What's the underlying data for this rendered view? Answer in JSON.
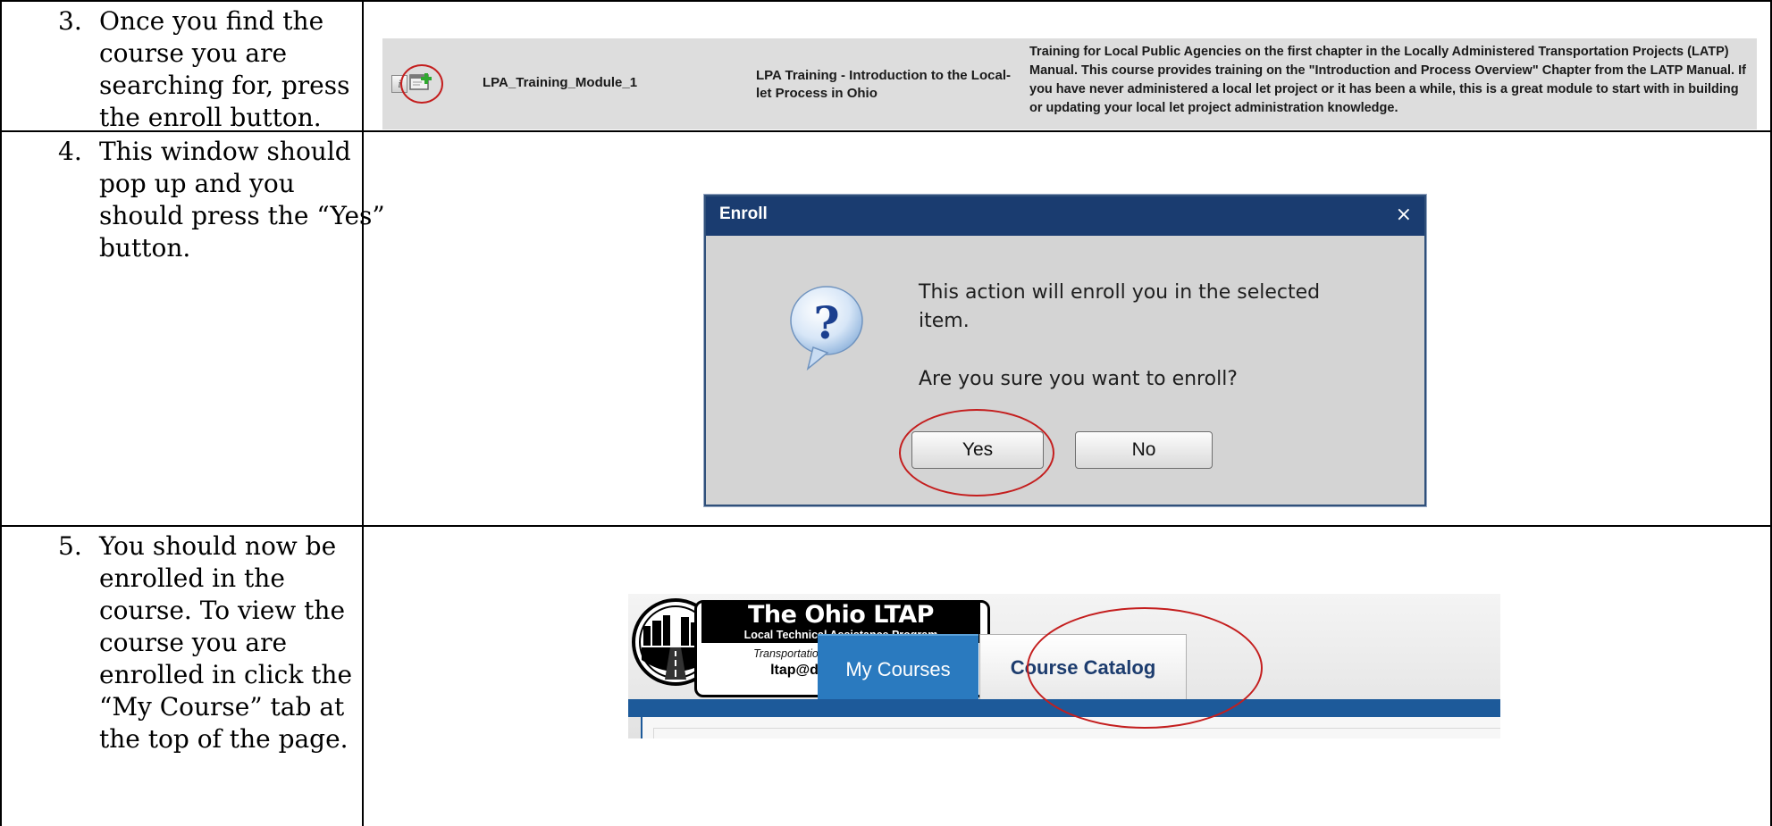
{
  "steps": [
    {
      "number": "3.",
      "text": "Once you find the course you are searching for, press the enroll button."
    },
    {
      "number": "4.",
      "text": "This window should pop up and you should press the “Yes” button."
    },
    {
      "number": "5.",
      "text": "You should now be enrolled in the course. To view the course you are enrolled in click the “My Course” tab at the top of the page."
    }
  ],
  "catalog_row": {
    "info_icon": "info-icon",
    "enroll_icon": "enroll-add-icon",
    "course_code": "LPA_Training_Module_1",
    "course_title": "LPA Training - Introduction to the Local-let Process in Ohio",
    "course_description": "Training for Local Public Agencies on the first chapter in the Locally Administered Transportation Projects (LATP) Manual. This course provides training on the \"Introduction and Process Overview\" Chapter from the LATP Manual. If you have never administered a local let project or it has been a while, this is a great module to start with in building or updating your local let project administration knowledge."
  },
  "dialog": {
    "title": "Enroll",
    "close_label": "×",
    "message": "This action will enroll you in the selected item.",
    "question": "Are you sure you want to enroll?",
    "yes_label": "Yes",
    "no_label": "No",
    "icon": "question-mark-icon"
  },
  "ltap_header": {
    "logo_title": "The Ohio LTAP Center",
    "logo_subtitle": "Local Technical Assistance Program",
    "logo_tagline": "Transportation Technology Transfer",
    "logo_email": "ltap@dot.state.oh.us",
    "tabs": [
      {
        "label": "My Courses",
        "active": true
      },
      {
        "label": "Course Catalog",
        "active": false
      }
    ]
  },
  "colors": {
    "highlight_circle": "#c41e1e",
    "dialog_titlebar": "#1a3c70",
    "active_tab": "#2a7abf",
    "nav_bar": "#1d5a9a"
  }
}
